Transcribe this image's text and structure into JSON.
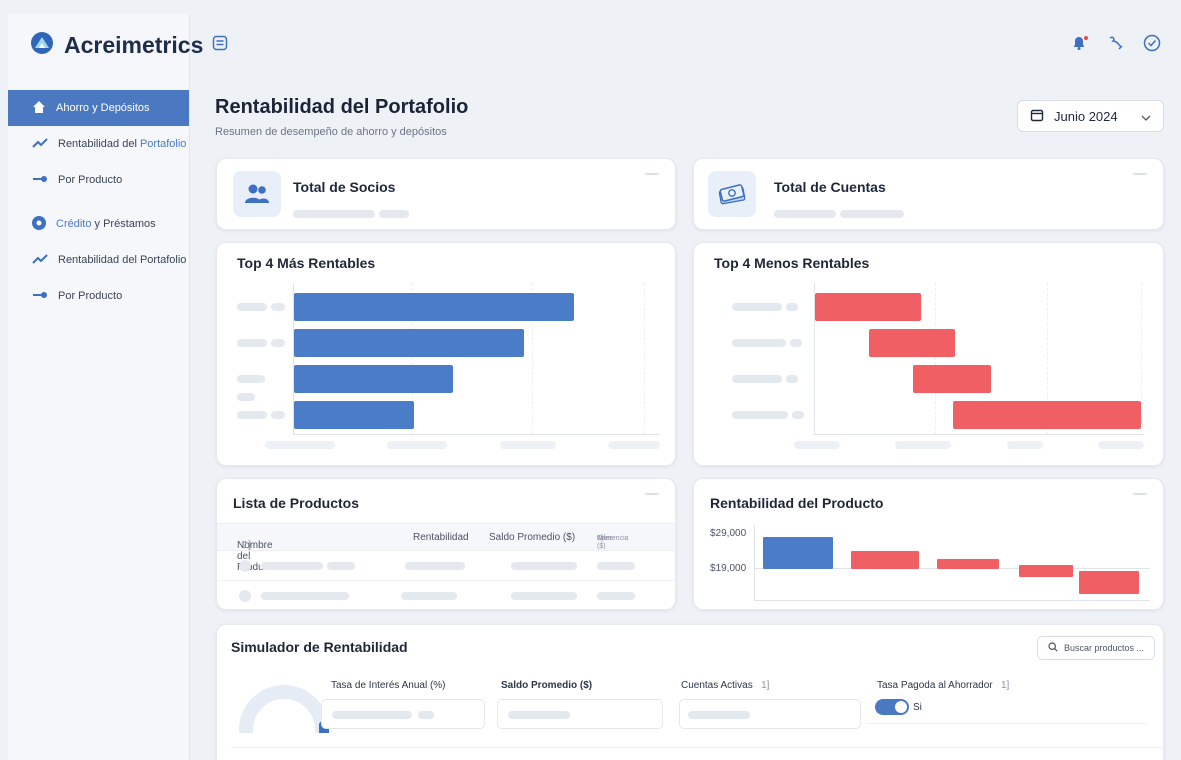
{
  "brand": {
    "name": "Acreimetrics"
  },
  "sidebar": {
    "sections": [
      {
        "label": "Ahorro y Depósitos",
        "icon": "home-icon",
        "items": [
          {
            "label_a": "Rentabilidad del ",
            "label_b": "Portafolio"
          },
          {
            "label_a": "Por Producto",
            "label_b": ""
          }
        ]
      },
      {
        "label_a": "Crédito",
        "label_b": " y Préstamos",
        "icon": "circle-icon",
        "items": [
          {
            "label": "Rentabilidad del Portafolio"
          },
          {
            "label": "Por Producto"
          }
        ]
      }
    ]
  },
  "header": {
    "title": "Rentabilidad del Portafolio",
    "subtitle": "Resumen de desempeño de ahorro y depósitos",
    "month": "Junio 2024"
  },
  "kpis": [
    {
      "title": "Total de Socios",
      "icon": "users-icon"
    },
    {
      "title": "Total de Cuentas",
      "icon": "money-icon"
    }
  ],
  "top_rentables": {
    "title": "Top 4 Más Rentables",
    "color": "#4a7cc7",
    "values": [
      0.79,
      0.65,
      0.45,
      0.34
    ]
  },
  "top_menos": {
    "title": "Top 4 Menos Rentables",
    "color": "#ef5f64"
  },
  "lista": {
    "title": "Lista de Productos",
    "columns": [
      "Nombre del Producto",
      "Rentabilidad",
      "Saldo Promedio ($)",
      "Diferencia",
      "wam ($)"
    ],
    "sort_glyph": "1]"
  },
  "rentabilidad_producto": {
    "title": "Rentabilidad del Producto",
    "ticks": [
      "$29,000",
      "$19,000"
    ]
  },
  "simulador": {
    "title": "Simulador de Rentabilidad",
    "search_placeholder": "Buscar productos ...",
    "fields": [
      "Tasa de Interés Anual (%)",
      "Saldo Promedio ($)",
      "Cuentas Activas",
      "Tasa Pagoda al Ahorrador"
    ],
    "sort_glyph": "1]",
    "toggle_label": "Si"
  },
  "colors": {
    "accent": "#4a79c2",
    "negative": "#ef5f64"
  }
}
